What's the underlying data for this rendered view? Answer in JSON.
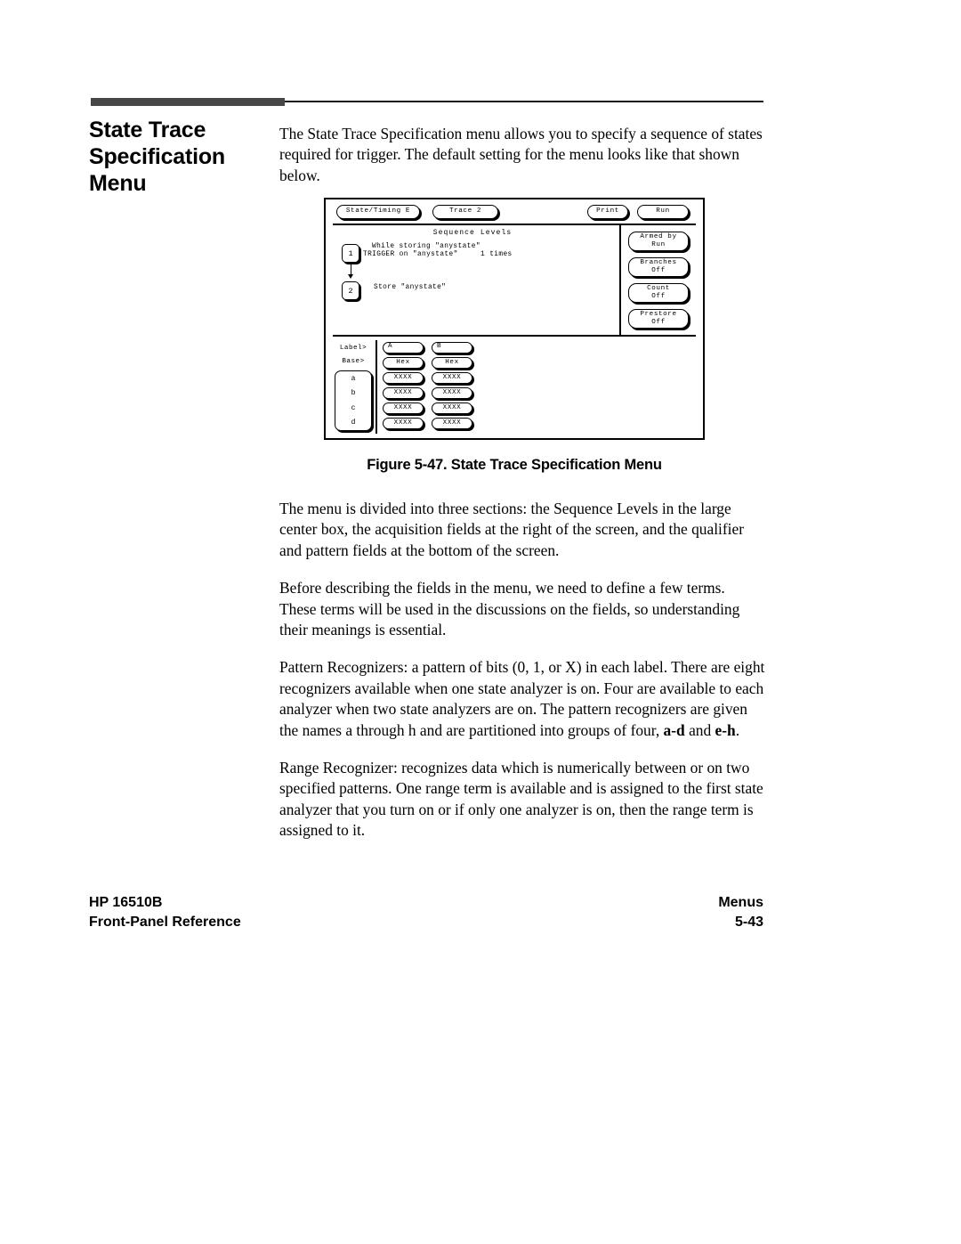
{
  "section": {
    "title_line1": "State Trace",
    "title_line2": "Specification",
    "title_line3": "Menu"
  },
  "body": {
    "intro": "The State Trace Specification menu allows you to specify a sequence of states required for trigger.  The default setting for the menu looks like that shown below.",
    "p_sections": "The menu is divided into three sections: the Sequence Levels in the large center box, the acquisition fields at the right of the screen, and the qualifier and pattern fields at the bottom of the screen.",
    "p_terms": "Before describing the fields in the menu, we need to define a few terms. These terms will be used in the discussions on the fields, so understanding their meanings is essential.",
    "p_pattern_a": "Pattern Recognizers: a pattern of bits (0, 1, or X) in each label. There are eight recognizers available when one state analyzer is on. Four are available to each analyzer when two state analyzers are on. The pattern recognizers are given the names a through h and are partitioned into groups of four, ",
    "p_pattern_bold1": "a-d",
    "p_pattern_mid": " and ",
    "p_pattern_bold2": "e-h",
    "p_pattern_end": ".",
    "p_range": "Range Recognizer: recognizes data which is numerically between or on two specified patterns. One range term is available and is assigned to the first state analyzer that you turn on or if only one analyzer is on, then the range term is assigned to it."
  },
  "figure": {
    "caption": "Figure 5-47. State Trace Specification Menu",
    "screen": {
      "topbar": {
        "machine_button": "State/Timing E",
        "menu_button": "Trace 2",
        "print_button": "Print",
        "run_button": "Run"
      },
      "sequence": {
        "heading": "Sequence Levels",
        "levels": [
          {
            "number": "1",
            "line1": "While storing \"anystate\"",
            "line2": "TRIGGER on \"anystate\"     1 times"
          },
          {
            "number": "2",
            "line1": "Store \"anystate\"",
            "line2": ""
          }
        ]
      },
      "acquisition": [
        {
          "label": "Armed by",
          "value": "Run"
        },
        {
          "label": "Branches",
          "value": "Off"
        },
        {
          "label": "Count",
          "value": "Off"
        },
        {
          "label": "Prestore",
          "value": "Off"
        }
      ],
      "pattern_panel": {
        "label_row_header": "Label>",
        "base_row_header": "Base>",
        "terms": [
          "a",
          "b",
          "c",
          "d"
        ],
        "columns": [
          {
            "label": "A",
            "base": "Hex",
            "patterns": [
              "XXXX",
              "XXXX",
              "XXXX",
              "XXXX"
            ]
          },
          {
            "label": "B",
            "base": "Hex",
            "patterns": [
              "XXXX",
              "XXXX",
              "XXXX",
              "XXXX"
            ]
          }
        ]
      }
    }
  },
  "footer": {
    "left_line1": "HP 16510B",
    "left_line2": "Front-Panel Reference",
    "right_line1": "Menus",
    "right_line2": "5-43"
  }
}
